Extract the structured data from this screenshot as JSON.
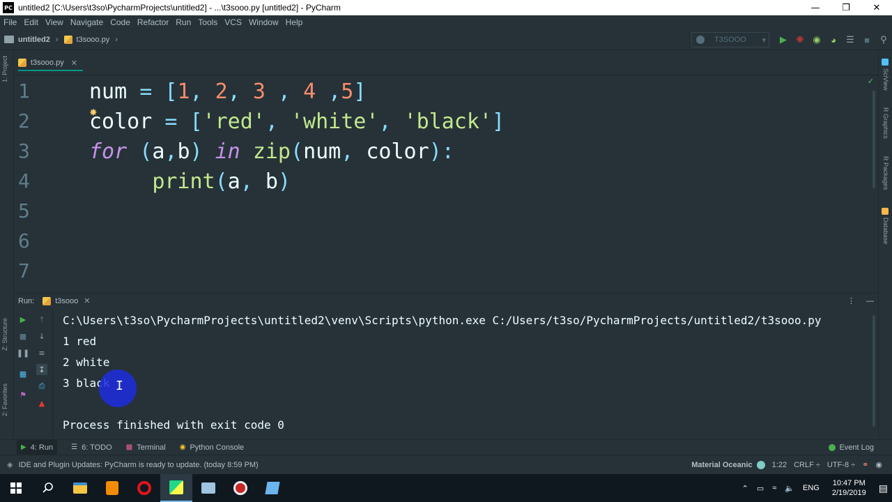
{
  "window": {
    "title": "untitled2 [C:\\Users\\t3so\\PycharmProjects\\untitled2] - ...\\t3sooo.py [untitled2] - PyCharm",
    "logo": "PC"
  },
  "menu": [
    "File",
    "Edit",
    "View",
    "Navigate",
    "Code",
    "Refactor",
    "Run",
    "Tools",
    "VCS",
    "Window",
    "Help"
  ],
  "nav": {
    "project": "untitled2",
    "file": "t3sooo.py",
    "run_config": "T3SOOO"
  },
  "left_strip": {
    "project_label": "1: Project",
    "structure_label": "Z: Structure",
    "favorites_label": "2: Favorites"
  },
  "right_strip": {
    "sciview": "SciView",
    "rgraphics": "R Graphics",
    "rpackages": "R Packages",
    "database": "Database"
  },
  "editor": {
    "tab": "t3sooo.py",
    "line_numbers": [
      "1",
      "2",
      "3",
      "4",
      "5",
      "6",
      "7"
    ],
    "code": {
      "l1": {
        "a": "num",
        "b": " = ",
        "c": "[",
        "d": "1",
        "e": ", ",
        "f": "2",
        "g": ", ",
        "h": "3",
        "i": " , ",
        "j": "4",
        "k": " ,",
        "l": "5",
        "m": "]"
      },
      "l2": {
        "a": "color",
        "b": " = ",
        "c": "[",
        "d": "'red'",
        "e": ", ",
        "f": "'white'",
        "g": ", ",
        "h": "'black'",
        "i": "]"
      },
      "l3": {
        "a": "for",
        "b": " (",
        "c": "a",
        "d": ",",
        "e": "b",
        "f": ") ",
        "g": "in",
        "h": " ",
        "i": "zip",
        "j": "(",
        "k": "num",
        "l": ", ",
        "m": "color",
        "n": "):"
      },
      "l4": {
        "indent": "     ",
        "a": "print",
        "b": "(",
        "c": "a",
        "d": ", ",
        "e": "b",
        "f": ")"
      }
    }
  },
  "run": {
    "label": "Run:",
    "tab": "t3sooo",
    "command": "C:\\Users\\t3so\\PycharmProjects\\untitled2\\venv\\Scripts\\python.exe C:/Users/t3so/PycharmProjects/untitled2/t3sooo.py",
    "output": [
      "1 red",
      "2 white",
      "3 black"
    ],
    "finished": "Process finished with exit code 0"
  },
  "bottom_tabs": {
    "run": "4: Run",
    "todo": "6: TODO",
    "terminal": "Terminal",
    "python_console": "Python Console",
    "event_log": "Event Log"
  },
  "status": {
    "update": "IDE and Plugin Updates: PyCharm is ready to update. (today 8:59 PM)",
    "theme": "Material Oceanic",
    "position": "1:22",
    "line_sep": "CRLF ÷",
    "encoding": "UTF-8 ÷"
  },
  "taskbar": {
    "lang": "ENG",
    "time": "10:47 PM",
    "date": "2/19/2019"
  },
  "colors": {
    "bg": "#263238",
    "accent": "#009688"
  }
}
